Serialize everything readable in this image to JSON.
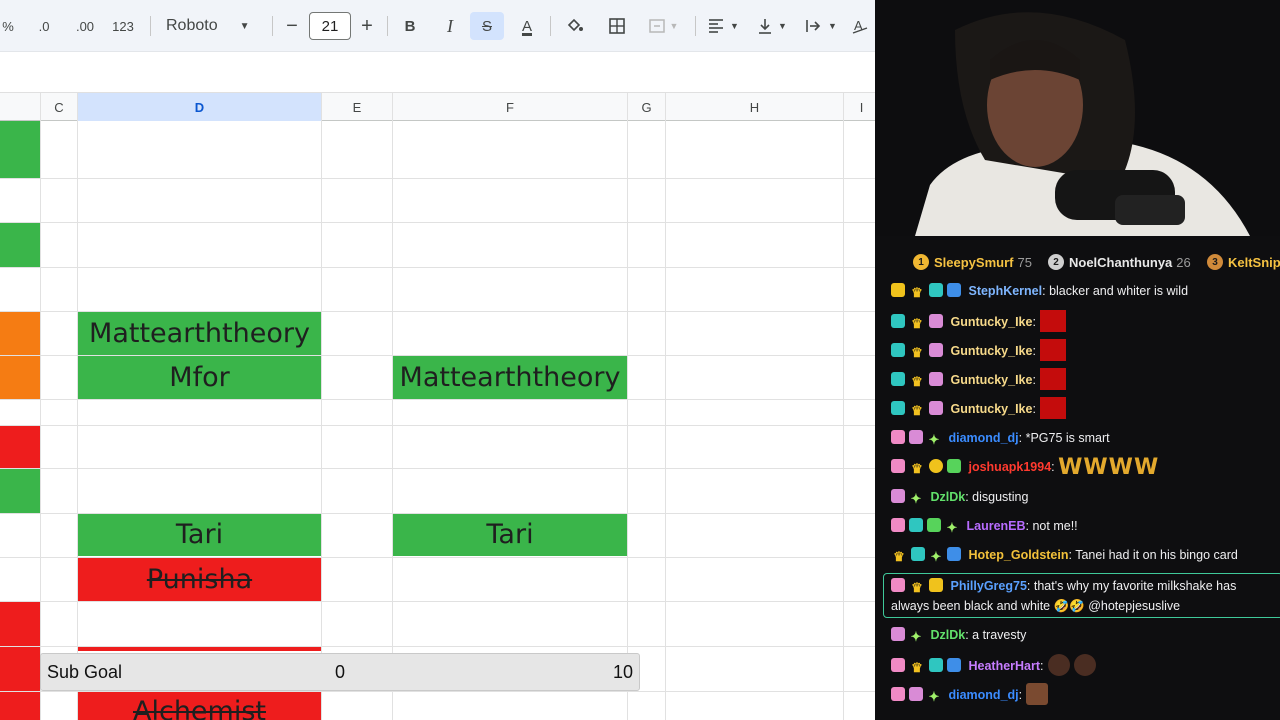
{
  "toolbar": {
    "percent": "%",
    "decrease_decimal": ".0",
    "increase_decimal": ".00",
    "number_format": "123",
    "font": "Roboto",
    "font_size_minus": "−",
    "font_size": "21",
    "font_size_plus": "+",
    "bold": "B",
    "italic": "I",
    "strikethrough": "S",
    "text_color": "A"
  },
  "columns": [
    {
      "id": "C",
      "label": "C"
    },
    {
      "id": "D",
      "label": "D"
    },
    {
      "id": "E",
      "label": "E"
    },
    {
      "id": "F",
      "label": "F"
    },
    {
      "id": "G",
      "label": "G"
    },
    {
      "id": "H",
      "label": "H"
    },
    {
      "id": "I",
      "label": "I"
    }
  ],
  "cells": {
    "d_matt": "Mattearththeory",
    "d_mfor": "Mfor",
    "f_matt": "Mattearththeory",
    "d_tari": "Tari",
    "f_tari": "Tari",
    "d_punisha": "Punisha",
    "d_alchemist": "Alchemist"
  },
  "sub_goal": {
    "label": "Sub Goal",
    "current": "0",
    "target": "10"
  },
  "colors": {
    "green": "#3ab54a",
    "orange": "#f57c13",
    "red": "#ee1d1d",
    "selected_col": "#d3e3fd"
  },
  "leaderboard": [
    {
      "rank": "1",
      "name": "SleepySmurf",
      "score": "75"
    },
    {
      "rank": "2",
      "name": "NoelChanthunya",
      "score": "26"
    },
    {
      "rank": "3",
      "name": "KeltSnip",
      "score": ""
    }
  ],
  "chat": [
    {
      "user": "StephKernel",
      "color": "#7fb6ff",
      "text": ": blacker and whiter is wild"
    },
    {
      "user": "Guntucky_Ike",
      "color": "#f6d98a",
      "text": ":"
    },
    {
      "user": "Guntucky_Ike",
      "color": "#f6d98a",
      "text": ":"
    },
    {
      "user": "Guntucky_Ike",
      "color": "#f6d98a",
      "text": ":"
    },
    {
      "user": "Guntucky_Ike",
      "color": "#f6d98a",
      "text": ":"
    },
    {
      "user": "diamond_dj",
      "color": "#3b8cff",
      "text": ": *PG75 is smart"
    },
    {
      "user": "joshuapk1994",
      "color": "#ff3a2f",
      "text": ":",
      "emote_text": "WWWW"
    },
    {
      "user": "DzlDk",
      "color": "#62e06b",
      "text": ": disgusting"
    },
    {
      "user": "LaurenEB",
      "color": "#b86cff",
      "text": ": not me!!"
    },
    {
      "user": "Hotep_Goldstein",
      "color": "#f3c13a",
      "text": ": Tanei had it on his bingo card"
    },
    {
      "user": "PhillyGreg75",
      "color": "#5aa0ff",
      "text": ": that's why my favorite milkshake has always been black and white 🤣🤣 @hotepjesuslive"
    },
    {
      "user": "DzlDk",
      "color": "#62e06b",
      "text": ": a travesty"
    },
    {
      "user": "HeatherHart",
      "color": "#c77dff",
      "text": ":"
    },
    {
      "user": "diamond_dj",
      "color": "#3b8cff",
      "text": ":"
    }
  ]
}
